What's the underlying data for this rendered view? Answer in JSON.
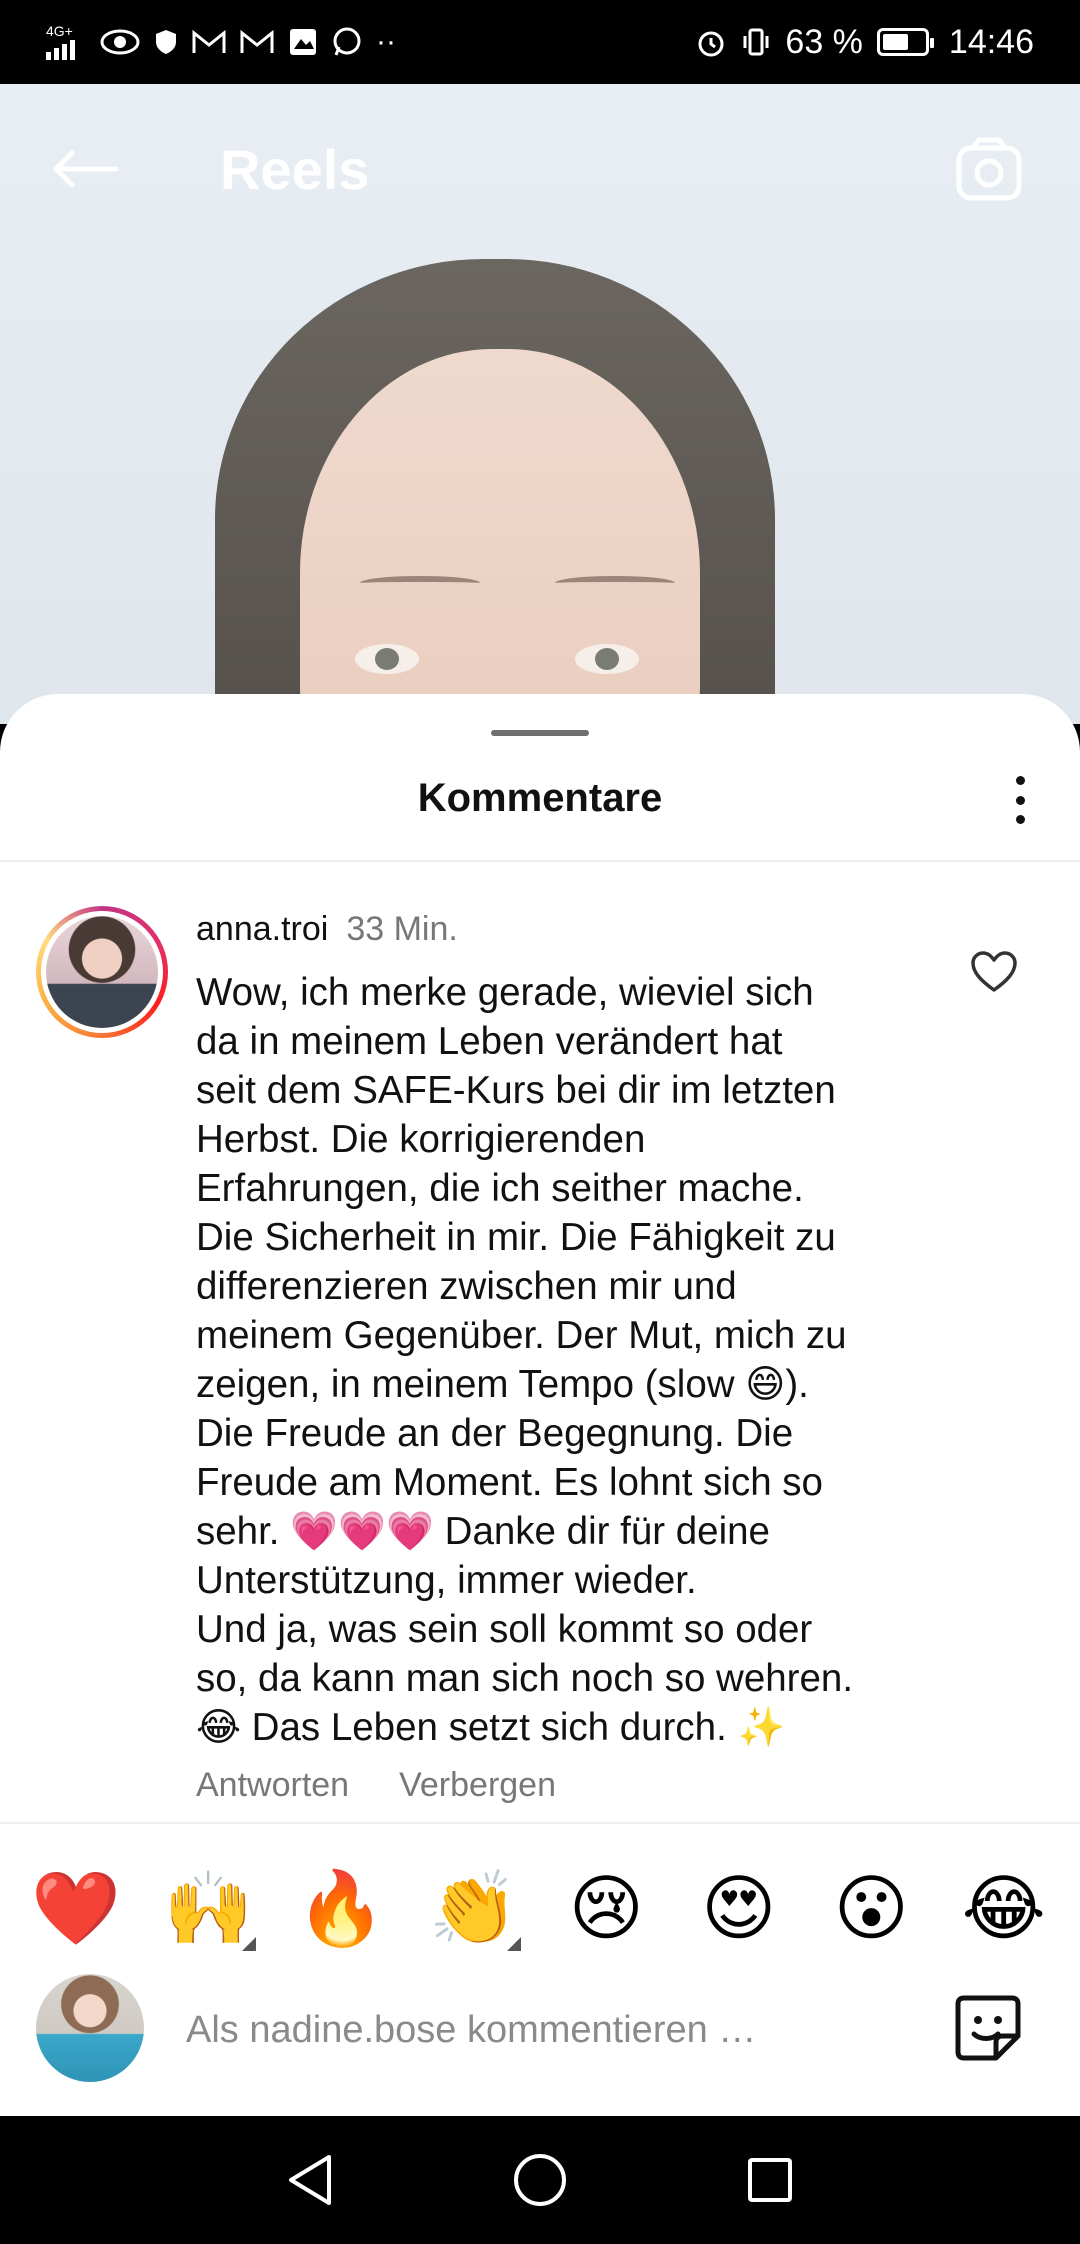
{
  "status_bar": {
    "left_icons": [
      "signal-icon",
      "eye-icon",
      "shield-icon",
      "gmail-icon",
      "gmail-icon",
      "gallery-icon",
      "whatsapp-icon",
      "more-dots-icon"
    ],
    "network": "4G+",
    "battery_percent": "63 %",
    "battery_level": 0.63,
    "time": "14:46"
  },
  "header": {
    "title": "Reels"
  },
  "sheet": {
    "title": "Kommentare"
  },
  "comment": {
    "username": "anna.troi",
    "time": "33 Min.",
    "text": "Wow, ich merke gerade, wieviel sich\nda in meinem Leben verändert hat\nseit dem SAFE-Kurs bei dir im letzten\nHerbst. Die korrigierenden\nErfahrungen, die ich seither mache.\nDie Sicherheit in mir. Die Fähigkeit zu\ndifferenzieren zwischen mir und\nmeinem Gegenüber. Der Mut, mich zu\nzeigen, in meinem Tempo (slow 😄).\nDie Freude an der Begegnung. Die\nFreude am Moment. Es lohnt sich so\nsehr. 💗💗💗 Danke dir für deine\nUnterstützung, immer wieder.\nUnd ja, was sein soll kommt so oder\nso, da kann man sich noch so wehren.\n😂 Das Leben setzt sich durch. ✨",
    "reply_label": "Antworten",
    "hide_label": "Verbergen"
  },
  "reactions": [
    "❤️",
    "🙌",
    "🔥",
    "👏",
    "😢",
    "😍",
    "😮",
    "😂"
  ],
  "compose": {
    "placeholder": "Als nadine.bose kommentieren …"
  },
  "colors": {
    "sheet_bg": "#ffffff",
    "text": "#111111",
    "muted": "#777777",
    "story_ring": "#e1306c"
  }
}
